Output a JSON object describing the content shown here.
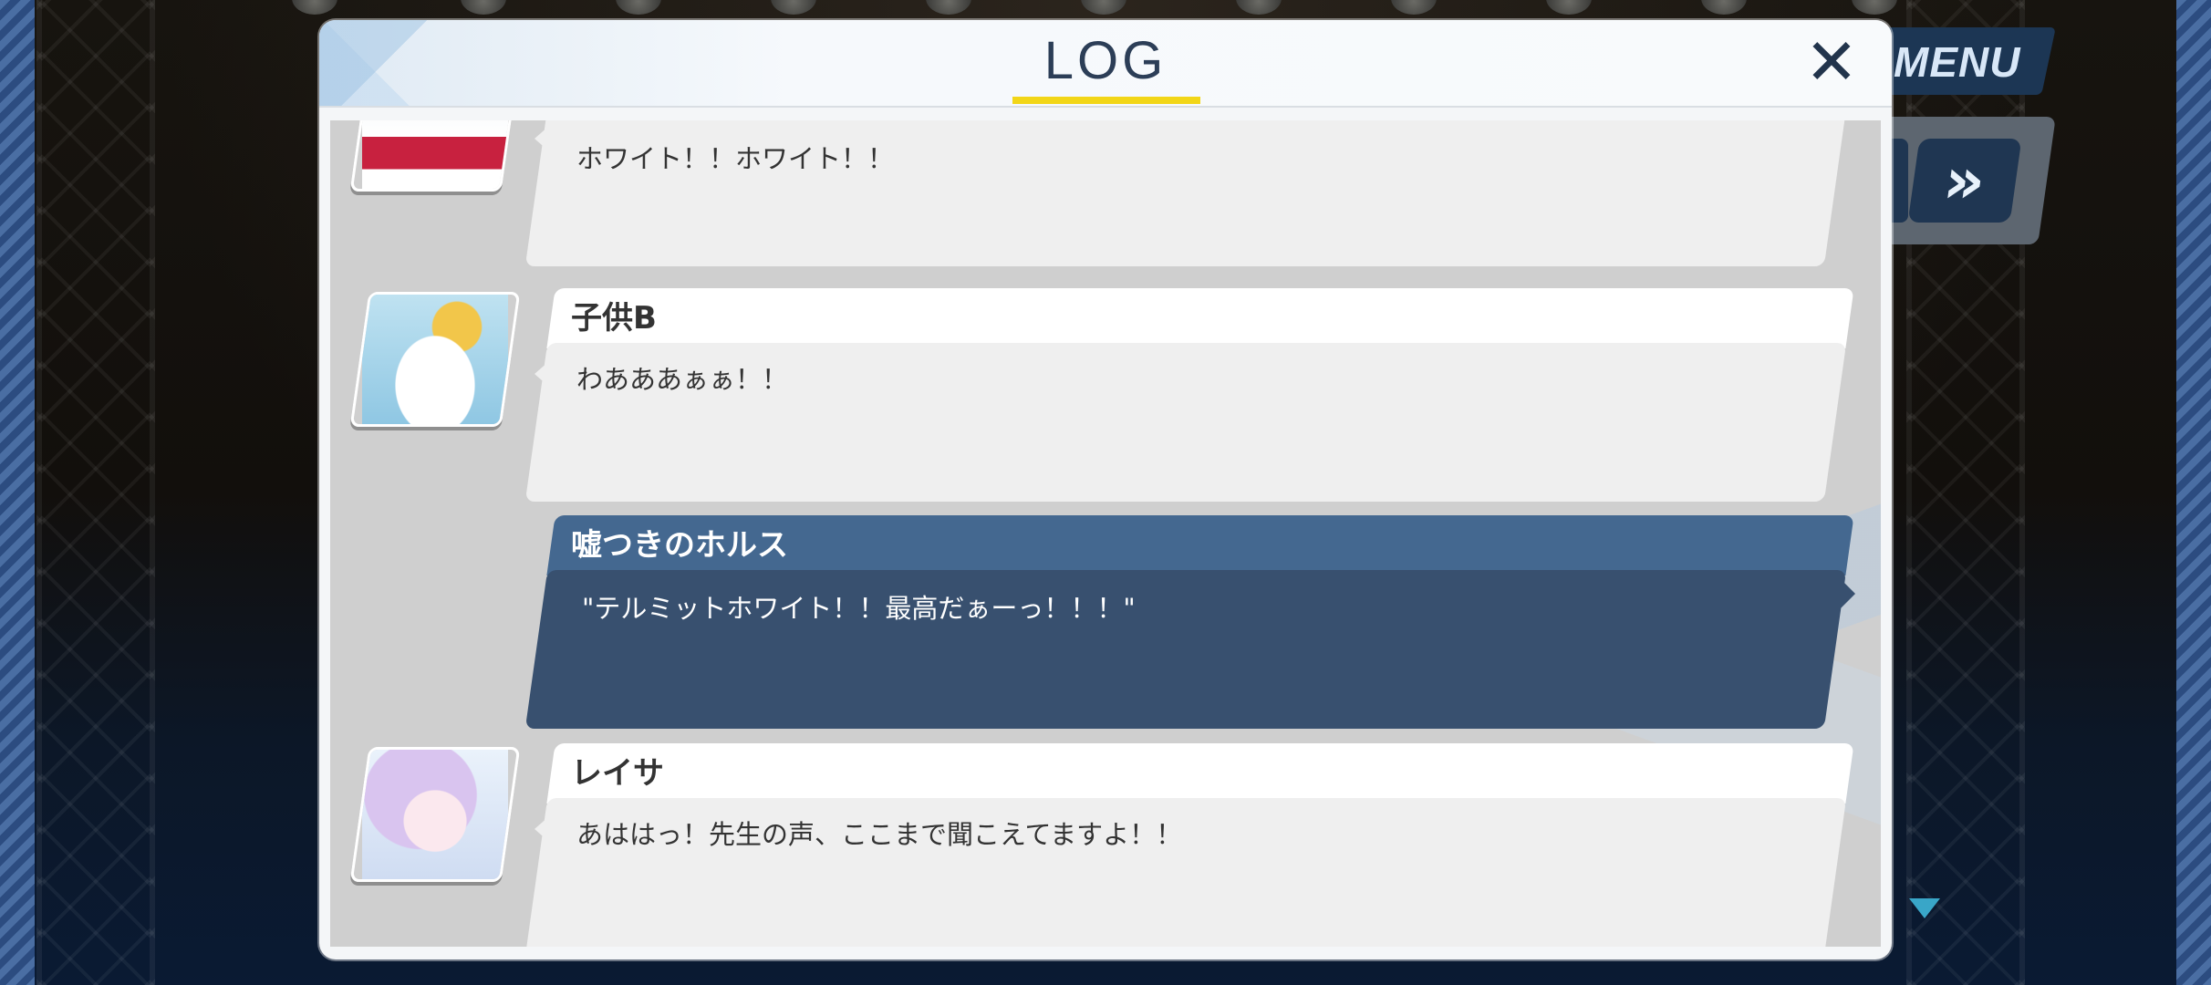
{
  "hud": {
    "menu_label": "MENU",
    "fast_forward_glyph": "»"
  },
  "log": {
    "title": "LOG",
    "close_glyph": "✕",
    "entries": [
      {
        "speaker": "",
        "text": "ホワイト！！ホワイト！！",
        "portrait": "seal-mascot-portrait",
        "is_player": false
      },
      {
        "speaker": "子供B",
        "text": "わあああぁぁ！！",
        "portrait": "seal-child-yellow-hat-portrait",
        "is_player": false
      },
      {
        "speaker": "嘘つきのホルス",
        "text": "\"テルミットホワイト！！最高だぁーっ！！！\"",
        "portrait": "",
        "is_player": true
      },
      {
        "speaker": "レイサ",
        "text": "あははっ！先生の声、ここまで聞こえてますよ！！",
        "portrait": "reisa-portrait",
        "is_player": false
      }
    ]
  },
  "colors": {
    "accent_underline": "#f2d618",
    "player_name_band": "#446890",
    "player_message_band": "#38506f",
    "scroll_arrow": "#39a6c8"
  }
}
